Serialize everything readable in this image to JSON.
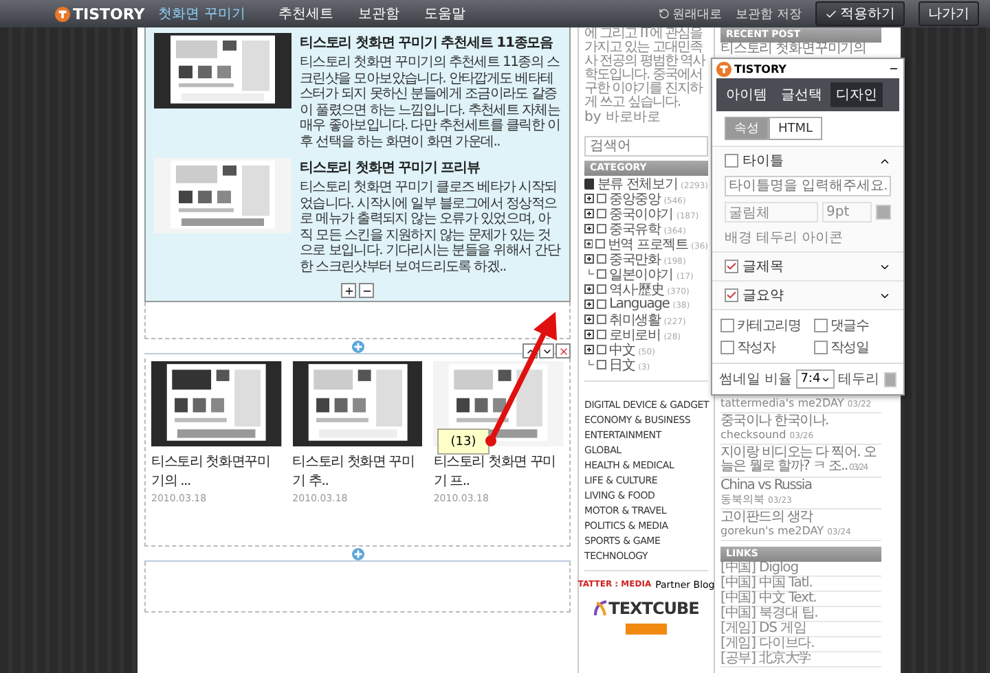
{
  "top_bar": {
    "logo": "TISTORY",
    "title": "첫화면 꾸미기",
    "nav": [
      "추천세트",
      "보관함",
      "도움말"
    ],
    "actions": [
      {
        "label": "원래대로",
        "kind": "undo"
      },
      {
        "label": "보관함 저장",
        "kind": "link"
      },
      {
        "label": "적용하기",
        "kind": "primary"
      },
      {
        "label": "나가기",
        "kind": "button"
      }
    ]
  },
  "editor": {
    "featured": [
      {
        "title": "티스토리 첫화면 꾸미기 추천세트 11종모음",
        "text": "티스토리 첫화면 꾸미기의 추천세트 11종의 스크린샷을 모아보았습니다. 안타깝게도 베타테스터가 되지 못하신 분들에게 조금이라도 갈증이 풀렸으면 하는 느낌입니다. 추천세트 자체는 매우 좋아보입니다. 다만 추천세트를 클릭한 이후 선택을 하는 화면이 화면 가운데.."
      },
      {
        "title": "티스토리 첫화면 꾸미기 프리뷰",
        "text": "티스토리 첫화면 꾸미기 클로즈 베타가 시작되었습니다. 시작시에 일부 블로그에서 정상적으로 메뉴가 출력되지 않는 오류가 있었으며, 아직 모든 스킨을 지원하지 않는 문제가 있는 것으로 보입니다. 기다리시는 분들을 위해서 간단한 스크린샷부터 보여드리도록 하겠.."
      }
    ],
    "gallery": [
      {
        "title": "티스토리 첫화면꾸미기의 ...",
        "date": "2010.03.18"
      },
      {
        "title": "티스토리 첫화면 꾸미기 추..",
        "date": "2010.03.18"
      },
      {
        "title": "티스토리 첫화면 꾸미기 프..",
        "date": "2010.03.18"
      }
    ],
    "annotation": "(13)"
  },
  "sidebar": {
    "profile": "에 그리고 IT에 관심을 가지고 있는 고대민족사 전공의 평범한 역사학도입니다. 중국에서 구한 이야기를 진지하게 쓰고 싶습니다.",
    "author": "by 바로바로",
    "search": {
      "placeholder": "검색어"
    },
    "category": {
      "title": "CATEGORY",
      "root": {
        "label": "분류 전체보기",
        "count": "(2293)"
      },
      "items": [
        {
          "label": "중앙중앙",
          "count": "(546)",
          "expandable": true
        },
        {
          "label": "중국이야기",
          "count": "(187)",
          "expandable": true
        },
        {
          "label": "중국유학",
          "count": "(364)",
          "expandable": true
        },
        {
          "label": "번역 프로젝트",
          "count": "(36)",
          "expandable": true
        },
        {
          "label": "중국만화",
          "count": "(198)",
          "expandable": true
        },
        {
          "label": "일본이야기",
          "count": "(17)",
          "expandable": false
        },
        {
          "label": "역사·歷史",
          "count": "(370)",
          "expandable": true
        },
        {
          "label": "Language",
          "count": "(38)",
          "expandable": true
        },
        {
          "label": "취미생활",
          "count": "(227)",
          "expandable": true
        },
        {
          "label": "로비로비",
          "count": "(28)",
          "expandable": true
        },
        {
          "label": "中文",
          "count": "(50)",
          "expandable": true
        },
        {
          "label": "日文",
          "count": "(3)",
          "expandable": false
        }
      ]
    },
    "tags": [
      "DIGITAL DEVICE & GADGET",
      "ECONOMY & BUSINESS",
      "ENTERTAINMENT",
      "GLOBAL",
      "HEALTH & MEDICAL",
      "LIFE & CULTURE",
      "LIVING & FOOD",
      "MOTOR & TRAVEL",
      "POLITICS & MEDIA",
      "SPORTS & GAME",
      "TECHNOLOGY"
    ],
    "partner": {
      "brand": "TATTER : MEDIA",
      "suffix": "Partner Blog",
      "textcube": "TEXTCUBE"
    }
  },
  "right": {
    "recent_title": "RECENT POST",
    "recent_first": "티스토리 첫화면꾸미기의",
    "comments": [
      {
        "author": "tattermedia's me2DAY",
        "date": "03/22"
      },
      {
        "text": "중국이나 한국이나.",
        "author": "checksound",
        "date": "03/26"
      },
      {
        "text": "지이랑 비디오는 다 찍어. 오늘은 뭘로 할까? ㅋ 조..",
        "date": "03/24"
      },
      {
        "text": "China vs Russia",
        "author": "동북의북",
        "date": "03/23"
      },
      {
        "text": "고이판드의 생각",
        "author": "gorekun's me2DAY",
        "date": "03/24"
      }
    ],
    "links_title": "LINKS",
    "links": [
      "[中国] Diglog",
      "[中国] 中国 Tatl.",
      "[中国] 中文 Text.",
      "[中国] 북경대 팁.",
      "[게임] DS 게임",
      "[게임] 다이브다.",
      "[공부] 北京大学"
    ]
  },
  "panel": {
    "logo": "TISTORY",
    "tabs": [
      {
        "label": "아이템",
        "selected": false
      },
      {
        "label": "글선택",
        "selected": false
      },
      {
        "label": "디자인",
        "selected": true
      }
    ],
    "modes": [
      {
        "label": "속성",
        "selected": true
      },
      {
        "label": "HTML",
        "selected": false
      }
    ],
    "title_section": {
      "label": "타이틀",
      "checked": false,
      "expanded": true,
      "placeholder": "타이틀명을 입력해주세요.",
      "font": "굴림체",
      "size": "9pt",
      "style_labels": [
        "배경",
        "테두리",
        "아이콘"
      ]
    },
    "sections": [
      {
        "label": "글제목",
        "checked": true,
        "expanded": false
      },
      {
        "label": "글요약",
        "checked": true,
        "expanded": false
      }
    ],
    "options": [
      {
        "label": "카테고리명",
        "checked": false
      },
      {
        "label": "댓글수",
        "checked": false
      },
      {
        "label": "작성자",
        "checked": false
      },
      {
        "label": "작성일",
        "checked": false
      }
    ],
    "ratio_label": "썸네일 비율",
    "ratio": "7:4",
    "border_label": "테두리"
  }
}
